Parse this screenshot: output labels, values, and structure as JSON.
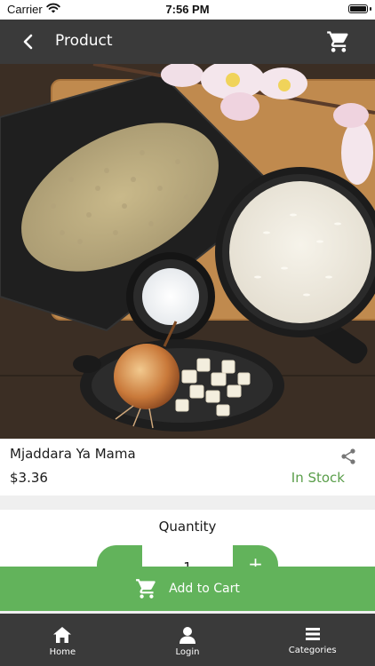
{
  "status_bar": {
    "carrier": "Carrier",
    "time": "7:56 PM"
  },
  "header": {
    "title": "Product",
    "back_icon": "chevron-left-icon",
    "cart_icon": "cart-icon"
  },
  "product": {
    "name": "Mjaddara Ya Mama",
    "price": "$3.36",
    "stock_status": "In Stock",
    "share_icon": "share-icon"
  },
  "quantity": {
    "label": "Quantity",
    "value": "1",
    "increment_label": "+"
  },
  "add_to_cart": {
    "label": "Add to Cart",
    "icon": "cart-icon"
  },
  "bottom_nav": {
    "items": [
      {
        "label": "Home",
        "icon": "home-icon"
      },
      {
        "label": "Login",
        "icon": "user-icon"
      },
      {
        "label": "Categories",
        "icon": "menu-icon"
      }
    ]
  },
  "colors": {
    "accent": "#62b35b",
    "stock": "#5a9e4a",
    "header_bg": "#3a3a3a",
    "page_bg": "#efefef"
  }
}
